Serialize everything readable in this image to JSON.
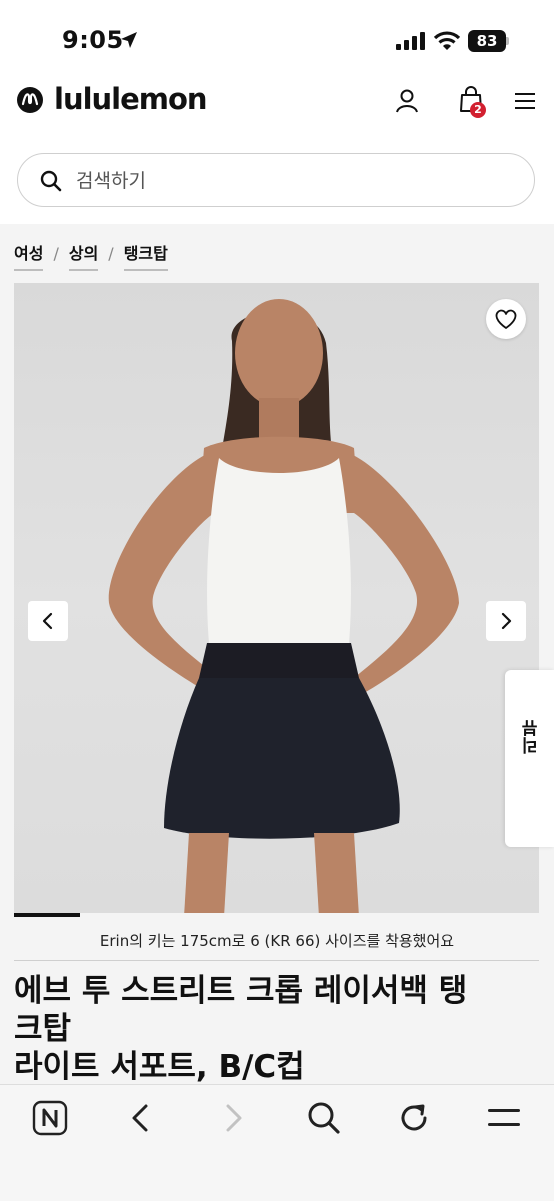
{
  "status_bar": {
    "time": "9:05",
    "battery": "83"
  },
  "header": {
    "brand": "lululemon",
    "bag_count": "2"
  },
  "search": {
    "placeholder": "검색하기"
  },
  "breadcrumb": [
    {
      "label": "여성"
    },
    {
      "label": "상의"
    },
    {
      "label": "탱크탑"
    }
  ],
  "gallery": {
    "progress_fraction": 0.125
  },
  "review_tab": {
    "label": "리뷰"
  },
  "fit_note": "Erin의 키는 175cm로 6 (KR 66) 사이즈를 착용했어요",
  "product": {
    "title_line1": "에브 투 스트리트 크롭 레이서백 탱",
    "title_line2": "크탑",
    "title_line3": "라이트 서포트, B/C컵"
  },
  "icons": {
    "status": [
      "location-arrow-icon",
      "signal-icon",
      "wifi-icon",
      "battery-icon"
    ],
    "header": [
      "lululemon-logo-icon",
      "account-icon",
      "shopping-bag-icon",
      "menu-icon"
    ],
    "bottom_bar": [
      "naver-n-icon",
      "back-icon",
      "forward-icon",
      "search-icon",
      "reload-icon",
      "menu-icon"
    ]
  }
}
